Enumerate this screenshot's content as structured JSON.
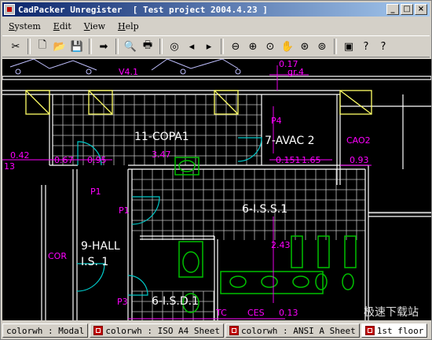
{
  "window": {
    "title": "CadPacker Unregister  [ Test project 2004.4.23 ]",
    "controls": {
      "minimize": "_",
      "maximize": "□",
      "close": "×"
    }
  },
  "menu": {
    "items": [
      {
        "key": "S",
        "rest": "ystem"
      },
      {
        "key": "E",
        "rest": "dit"
      },
      {
        "key": "V",
        "rest": "iew"
      },
      {
        "key": "H",
        "rest": "elp"
      }
    ]
  },
  "toolbar": {
    "icons": [
      "wrench-icon",
      "separator",
      "new-file-icon",
      "open-folder-icon",
      "save-icon",
      "separator",
      "export-icon",
      "separator",
      "print-preview-icon",
      "print-icon",
      "separator",
      "view-toggle-icon",
      "previous-page-icon",
      "next-page-icon",
      "separator",
      "zoom-out-icon",
      "zoom-in-icon",
      "zoom-window-icon",
      "pan-icon",
      "zoom-realtime-icon",
      "zoom-extents-icon",
      "separator",
      "properties-icon",
      "context-help-icon",
      "help-icon"
    ],
    "glyphs": {
      "wrench-icon": "✂",
      "new-file-icon": "🗋",
      "open-folder-icon": "📂",
      "save-icon": "💾",
      "export-icon": "➡",
      "print-preview-icon": "🔍",
      "print-icon": "🖶",
      "view-toggle-icon": "◎",
      "previous-page-icon": "◂",
      "next-page-icon": "▸",
      "zoom-out-icon": "⊖",
      "zoom-in-icon": "⊕",
      "zoom-window-icon": "⊙",
      "pan-icon": "✋",
      "zoom-realtime-icon": "⊛",
      "zoom-extents-icon": "⊚",
      "properties-icon": "▣",
      "context-help-icon": "?",
      "help-icon": "?"
    }
  },
  "drawing": {
    "room_labels": {
      "copa": "11-COPA1",
      "avac": "7-AVAC  2",
      "iss": "6-I.S.S.1",
      "hall1": "9-HALL",
      "hall2": "I.S.  1",
      "isd": "6-I.S.D.1"
    },
    "dimensions": {
      "v41": "V4.1",
      "d017": "0.17",
      "gr4": "gr.4",
      "p4": "P4",
      "cao2": "CAO2",
      "d042": "0.42",
      "d13": "13",
      "d067": "0.67",
      "d095": "0.95",
      "d347": "3.47",
      "d0151": "0.151",
      "d165": "1.65",
      "d093": "0.93",
      "p1a": "P1",
      "p1b": "P1",
      "d243": "2.43",
      "cor": "COR",
      "p3": "P3",
      "tc": "TC",
      "ces": "CES",
      "d613": "0.13"
    },
    "watermark": "极速下载站"
  },
  "status": {
    "tabs": [
      {
        "label": "colorwh : Modal",
        "icon": false,
        "active": false
      },
      {
        "label": "colorwh : ISO A4 Sheet",
        "icon": true,
        "active": false
      },
      {
        "label": "colorwh : ANSI A Sheet",
        "icon": true,
        "active": false
      },
      {
        "label": "1st floor",
        "icon": true,
        "active": true
      }
    ]
  },
  "colors": {
    "background": "#000000",
    "wall": "#ffffff",
    "grid": "#c0c0c0",
    "dimension": "#ff00ff",
    "door": "#00c8c8",
    "fixture": "#00c000",
    "beam": "#ffff66",
    "title_start": "#0a246a"
  }
}
